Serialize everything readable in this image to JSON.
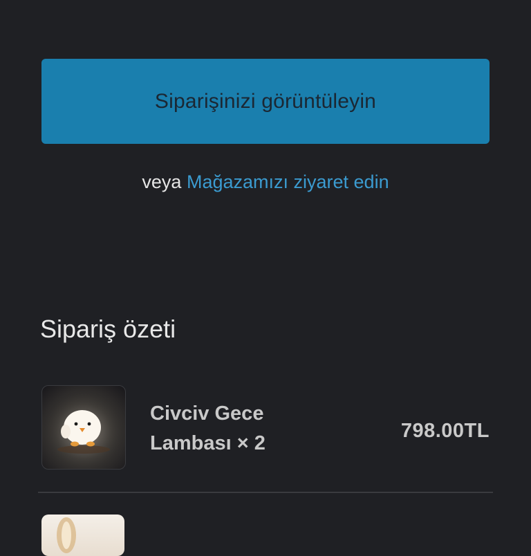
{
  "actions": {
    "view_order_label": "Siparişinizi görüntüleyin",
    "or_text": "veya",
    "visit_store_label": "Mağazamızı ziyaret edin"
  },
  "summary": {
    "title": "Sipariş özeti",
    "items": [
      {
        "name": "Civciv Gece Lambası × 2",
        "price": "798.00TL",
        "image_icon": "chick-night-lamp-image"
      },
      {
        "image_icon": "product-image"
      }
    ]
  },
  "colors": {
    "background": "#1f2024",
    "accent_button": "#1a7fae",
    "link": "#3b9bd0"
  }
}
